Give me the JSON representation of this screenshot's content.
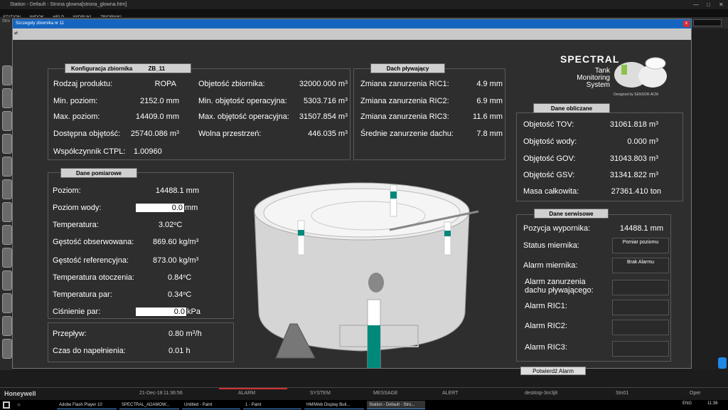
{
  "window": {
    "title": "Station - Default - Strona glowna[strona_glowna.htm]"
  },
  "menu": [
    "STATION",
    "WIDOK",
    "HELP",
    "WIDRUKI",
    "ZBIORNIKI"
  ],
  "strip_label": "Stro",
  "dialog": {
    "title": "Szczegoly zbiornika nr 11",
    "tool_icon": "⇄"
  },
  "config": {
    "title": "Konfiguracja zbiornika",
    "tank_id": "ZB_11",
    "rows_left": [
      {
        "label": "Rodzaj produktu:",
        "value": "ROPA"
      },
      {
        "label": "Min. poziom:",
        "value": "2152.0 mm"
      },
      {
        "label": "Max. poziom:",
        "value": "14409.0 mm"
      },
      {
        "label": "Dostępna objętość:",
        "value": "25740.086 m",
        "sup": "3"
      },
      {
        "label": "Współczynnik CTPL:",
        "value": "1.00960"
      }
    ],
    "rows_right": [
      {
        "label": "Objetość zbiornika:",
        "value": "32000.000 m",
        "sup": "3"
      },
      {
        "label": "Min. objętość operacyjna:",
        "value": "5303.716 m",
        "sup": "3"
      },
      {
        "label": "Max. objętość operacyjna:",
        "value": "31507.854 m",
        "sup": "3"
      },
      {
        "label": "Wolna przestrzeń:",
        "value": "446.035 m",
        "sup": "3"
      }
    ]
  },
  "roof": {
    "title": "Dach pływający",
    "rows": [
      {
        "label": "Zmiana zanurzenia RIC1:",
        "value": "4.9 mm"
      },
      {
        "label": "Zmiana zanurzenia RIC2:",
        "value": "6.9 mm"
      },
      {
        "label": "Zmiana zanurzenia RIC3:",
        "value": "11.6 mm"
      },
      {
        "label": "Średnie zanurzenie dachu:",
        "value": "7.8 mm"
      }
    ]
  },
  "logo": {
    "brand": "SPECTRAL",
    "line1": "Tank",
    "line2": "Monitoring",
    "line3": "System",
    "credit": "Designed by SENSOR-ACM"
  },
  "calc": {
    "title": "Dane obliczane",
    "rows": [
      {
        "label": "Objetość TOV:",
        "value": "31061.818 m",
        "sup": "3"
      },
      {
        "label": "Objętość wody:",
        "value": "0.000 m",
        "sup": "3"
      },
      {
        "label": "Objętość GOV:",
        "value": "31043.803 m",
        "sup": "3"
      },
      {
        "label": "Objętość GSV:",
        "value": "31341.822 m",
        "sup": "3"
      },
      {
        "label": "Masa całkowita:",
        "value": "27361.410 ton"
      }
    ]
  },
  "measure": {
    "title": "Dane pomiarowe",
    "level": {
      "label": "Poziom:",
      "value": "14488.1 mm"
    },
    "water": {
      "label": "Poziom wody:",
      "value": "0.0",
      "unit": "mm"
    },
    "temp": {
      "label": "Temperatura:",
      "value": "3.02",
      "sup": "o",
      "unit": "C"
    },
    "dens_obs": {
      "label": "Gęstość obserwowana:",
      "value": "869.60 kg/m",
      "sup": "3"
    },
    "dens_ref": {
      "label": "Gęstość referencyjna:",
      "value": "873.00 kg/m",
      "sup": "3"
    },
    "temp_amb": {
      "label": "Temperatura otoczenia:",
      "value": "0.84",
      "sup": "o",
      "unit": "C"
    },
    "temp_vap": {
      "label": "Temperatura par:",
      "value": "0.34",
      "sup": "o",
      "unit": "C"
    },
    "press": {
      "label": "Ciśnienie par:",
      "value": "0.0",
      "unit": "kPa"
    }
  },
  "flow": {
    "flow": {
      "label": "Przepływ:",
      "value": "0.80 m",
      "sup": "3",
      "unit": "/h"
    },
    "time": {
      "label": "Czas do napełnienia:",
      "value": "0.01 h"
    }
  },
  "service": {
    "title": "Dane serwisowe",
    "pos": {
      "label": "Pozycja wypornika:",
      "value": "14488.1 mm"
    },
    "status": {
      "label": "Status miernika:",
      "value": "Pomiar poziomu"
    },
    "alarm": {
      "label": "Alarm miernika:",
      "value": "Brak Alarmu"
    },
    "alarm_roof_1": "Alarm zanurzenia",
    "alarm_roof_2": "dachu pływającego:",
    "ric1": "Alarm RIC1:",
    "ric2": "Alarm RIC2:",
    "ric3": "Alarm RIC3:"
  },
  "gauges": {
    "main_fill": 0.66,
    "side_fill": 0.35
  },
  "confirm_button": "Potwierdź Alarm",
  "bottom": {
    "brand": "Honeywell",
    "date": "21-Dec-18",
    "time": "11:36:56",
    "alarm": "ALARM",
    "system": "SYSTEM",
    "message": "MESSAGE",
    "alert": "ALERT",
    "host": "desktop-3nr3j8",
    "stn": "Stn01",
    "oper": "Oper"
  },
  "taskbar": {
    "items": [
      "Adobe Flash Player 10",
      "SPECTRAL_ADAMOW...",
      "Untitled - Paint",
      "1 - Paint",
      "HMIWeb Display Buil...",
      "Station - Default - Stro..."
    ],
    "lang": "ENG",
    "clock": "11:36"
  },
  "colors": {
    "accent": "#1565c0",
    "gauge": "#00897b",
    "alarm_red": "#d32f2f"
  }
}
